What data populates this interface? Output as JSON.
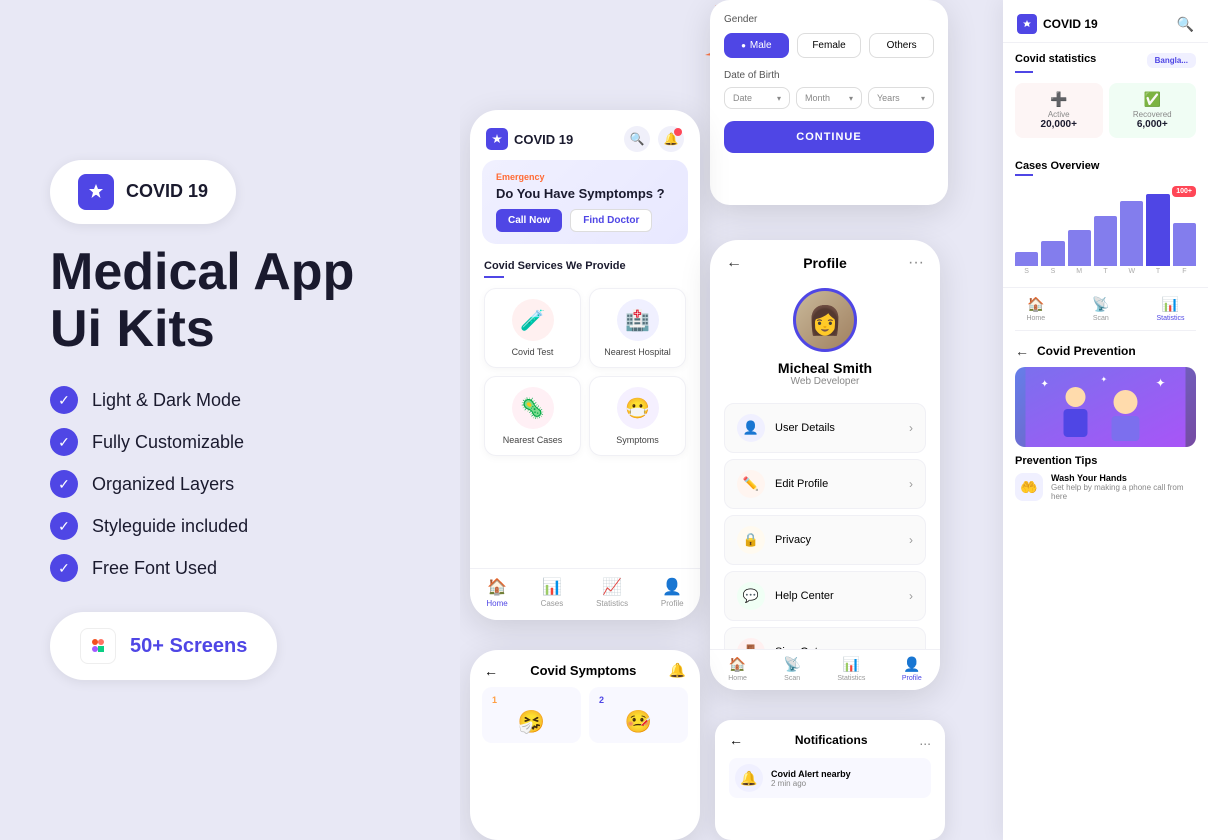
{
  "left": {
    "logo": "COVID 19",
    "title_line1": "Medical App",
    "title_line2": "Ui Kits",
    "features": [
      "Light & Dark Mode",
      "Fully Customizable",
      "Organized Layers",
      "Styleguide included",
      "Free Font Used"
    ],
    "screens_count": "50+ Screens"
  },
  "phone_main": {
    "app_name": "COVID 19",
    "emergency_label": "Emergency",
    "banner_title": "Do You Have Symptomps ?",
    "call_btn": "Call Now",
    "find_btn": "Find Doctor",
    "services_title": "Covid Services We Provide",
    "services": [
      {
        "label": "Covid Test",
        "icon": "🧪",
        "bg": "#fff0f0"
      },
      {
        "label": "Nearest Hospital",
        "icon": "🏥",
        "bg": "#f0f0ff"
      },
      {
        "label": "Nearest Cases",
        "icon": "🦠",
        "bg": "#fff0f5"
      },
      {
        "label": "Symptoms",
        "icon": "🤒",
        "bg": "#f5f0ff"
      }
    ],
    "nav": [
      "Home",
      "Cases",
      "Statistics",
      "Profile"
    ]
  },
  "registration": {
    "gender_label": "Gender",
    "gender_options": [
      "Male",
      "Female",
      "Others"
    ],
    "active_gender": "Male",
    "dob_label": "Date of Birth",
    "dob_placeholders": [
      "Date",
      "Month",
      "Years"
    ],
    "continue_btn": "CONTINUE"
  },
  "profile": {
    "title": "Profile",
    "name": "Micheal Smith",
    "role": "Web Developer",
    "menu_items": [
      {
        "label": "User Details",
        "icon": "👤",
        "bg": "#f0f0ff"
      },
      {
        "label": "Edit Profile",
        "icon": "✏️",
        "bg": "#fff5f0"
      },
      {
        "label": "Privacy",
        "icon": "🔒",
        "bg": "#fffaf0"
      },
      {
        "label": "Help Center",
        "icon": "💬",
        "bg": "#f0fff5"
      },
      {
        "label": "Sign Out",
        "icon": "🚪",
        "bg": "#fff0f0"
      }
    ]
  },
  "symptoms_screen": {
    "title": "Covid Symptoms",
    "items": [
      {
        "num": "1",
        "color": "orange"
      },
      {
        "num": "2",
        "color": "blue"
      }
    ]
  },
  "dashboard": {
    "app_name": "COVID 19",
    "stats_title": "Covid statistics",
    "region": "Bangla...",
    "stats": [
      {
        "label": "Active",
        "value": "20,000+",
        "icon": "➕"
      },
      {
        "label": "Recovered",
        "value": "6,000+",
        "icon": "✅"
      }
    ],
    "cases_title": "Cases Overview",
    "chart_badge": "100+",
    "chart_bars": [
      20,
      35,
      50,
      70,
      90,
      100,
      60
    ],
    "chart_labels": [
      "S",
      "S",
      "M",
      "T",
      "W",
      "T",
      "F"
    ],
    "nav_items": [
      "Home",
      "Scan",
      "Statistics",
      ""
    ],
    "prevention_title": "Covid Prevention",
    "back_label": "←",
    "prevention_tips_title": "Prevention Tips",
    "tip_title": "Wash Your Hands",
    "tip_desc": "Get help by making a phone call from here"
  },
  "notifications": {
    "title": "Notifications",
    "back": "←",
    "dots": "..."
  }
}
